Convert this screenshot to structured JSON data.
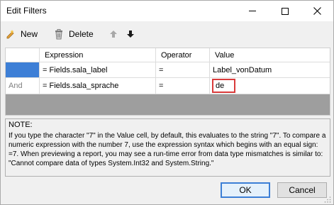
{
  "window": {
    "title": "Edit Filters"
  },
  "toolbar": {
    "new_label": "New",
    "delete_label": "Delete"
  },
  "grid": {
    "columns": [
      "",
      "Expression",
      "Operator",
      "Value"
    ],
    "rows": [
      {
        "logic": "",
        "expression": "= Fields.sala_label",
        "operator": "=",
        "value": "Label_vonDatum"
      },
      {
        "logic": "And",
        "expression": "= Fields.sala_sprache",
        "operator": "=",
        "value": "de"
      }
    ]
  },
  "note": {
    "title": "NOTE:",
    "text": "If you type the character \"7\" in the Value cell, by default, this evaluates to the string \"7\". To compare a numeric expression with the number 7, use the expression syntax which begins with an equal sign: =7. When previewing a report, you may see a run-time error from data type mismatches is similar to: \"Cannot compare data of types System.Int32 and System.String.\""
  },
  "buttons": {
    "ok": "OK",
    "cancel": "Cancel"
  },
  "colors": {
    "selection": "#3d7fd6",
    "highlight": "#d93a3a",
    "empty_area": "#9e9e9e"
  },
  "icons": [
    "new-icon",
    "delete-icon",
    "move-up-icon",
    "move-down-icon",
    "minimize-icon",
    "maximize-icon",
    "close-icon",
    "resize-grip-icon"
  ]
}
